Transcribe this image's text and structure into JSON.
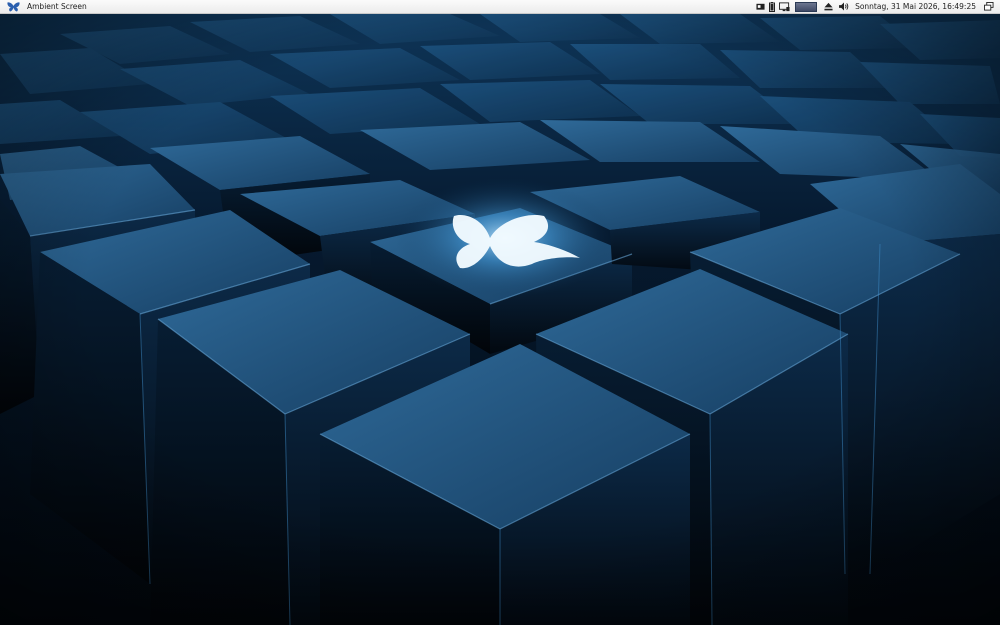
{
  "panel": {
    "app_title": "Ambient Screen",
    "clock": "Sonntag, 31 Mai 2026, 16:49:25",
    "menu_icon": "butterfly-icon",
    "tray_icons": [
      "media-card-icon",
      "battery-icon",
      "display-icon",
      "cpu-monitor-graph",
      "eject-icon",
      "volume-icon",
      "show-desktop-icon"
    ]
  },
  "desktop": {
    "wallpaper": "blue-cubes-butterfly",
    "accent": "#1d5a8c",
    "glow": "#bfe6ff"
  }
}
